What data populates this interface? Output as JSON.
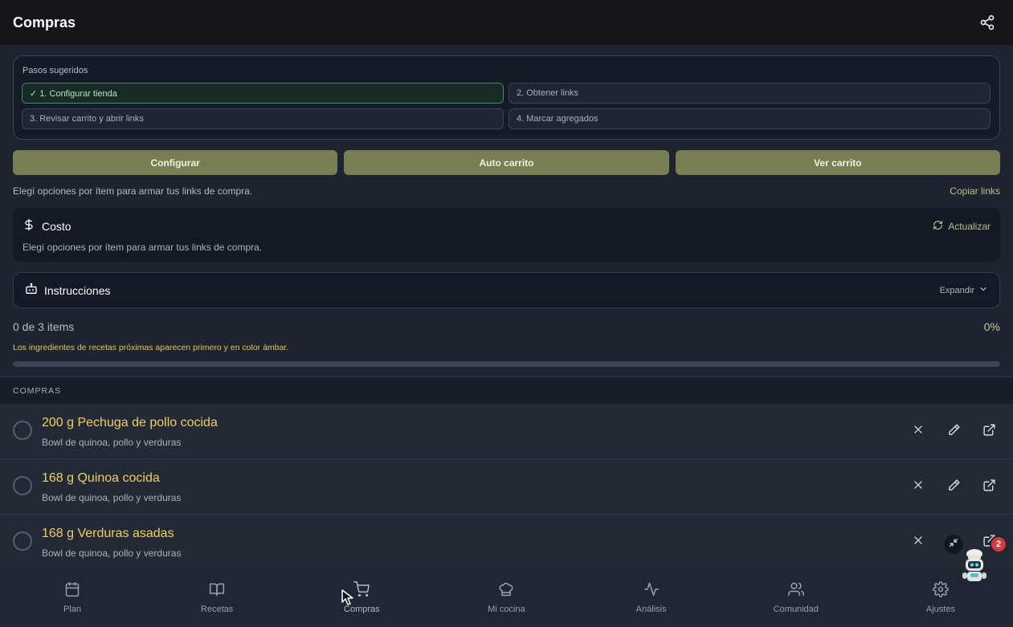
{
  "header": {
    "title": "Compras",
    "share_icon": "share-icon"
  },
  "steps": {
    "label": "Pasos sugeridos",
    "items": [
      {
        "label": "✓ 1. Configurar tienda",
        "done": true
      },
      {
        "label": "2. Obtener links",
        "done": false
      },
      {
        "label": "3. Revisar carrito y abrir links",
        "done": false
      },
      {
        "label": "4. Marcar agregados",
        "done": false
      }
    ]
  },
  "actions": {
    "configure": "Configurar",
    "auto_cart": "Auto carrito",
    "view_cart": "Ver carrito"
  },
  "hint": {
    "text": "Elegí opciones por ítem para armar tus links de compra.",
    "copy_links": "Copiar links"
  },
  "cost": {
    "title": "Costo",
    "icon": "dollar-icon",
    "refresh": "Actualizar",
    "subtitle": "Elegí opciones por ítem para armar tus links de compra."
  },
  "instructions": {
    "title": "Instrucciones",
    "icon": "robot-icon",
    "expand": "Expandir"
  },
  "progress": {
    "count": "0 de 3 items",
    "percent_label": "0%",
    "value": 0,
    "note": "Los ingredientes de recetas próximas aparecen primero y en color ámbar."
  },
  "section": {
    "label": "COMPRAS"
  },
  "items": [
    {
      "name": "200 g Pechuga de pollo cocida",
      "recipe": "Bowl de quinoa, pollo y verduras"
    },
    {
      "name": "168 g Quinoa cocida",
      "recipe": "Bowl de quinoa, pollo y verduras"
    },
    {
      "name": "168 g Verduras asadas",
      "recipe": "Bowl de quinoa, pollo y verduras"
    }
  ],
  "nav": {
    "items": [
      {
        "label": "Plan",
        "icon": "calendar-icon"
      },
      {
        "label": "Recetas",
        "icon": "book-icon"
      },
      {
        "label": "Compras",
        "icon": "cart-icon",
        "active": true
      },
      {
        "label": "Mi cocina",
        "icon": "chef-hat-icon"
      },
      {
        "label": "Análisis",
        "icon": "activity-icon"
      },
      {
        "label": "Comunidad",
        "icon": "users-icon"
      },
      {
        "label": "Ajustes",
        "icon": "gear-icon"
      }
    ]
  },
  "assistant": {
    "badge_count": "2"
  },
  "colors": {
    "accent_olive": "#787d52",
    "amber": "#f2cd62",
    "danger": "#d33b3b"
  }
}
